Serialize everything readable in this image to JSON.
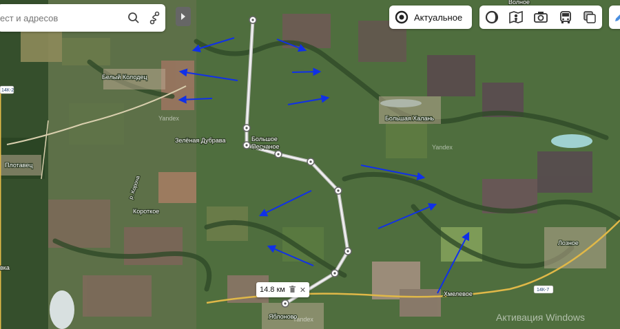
{
  "search": {
    "placeholder": "ест и адресов"
  },
  "actual_button": {
    "label": "Актуальное"
  },
  "layers": [
    "traffic-icon",
    "panorama-icon",
    "photo-icon",
    "transit-icon",
    "layers-icon"
  ],
  "distance": {
    "value": "14.8 км"
  },
  "places": {
    "belyi_kolodets": "Белый Колодец",
    "plotavets": "Плотавец",
    "zelenaya_dubrava": "Зелёная Дубрава",
    "bolshoe": "Большое",
    "pesschanoe": "Песчаное",
    "bolshaya_khalan": "Большая Халань",
    "korotkoe": "Короткое",
    "r_korocha": "р. Короча",
    "loznoe": "Лозное",
    "khmelevoe": "Хмелевое",
    "yablonovo": "Яблоново",
    "volkovka": "вка",
    "volnoe": "Волное"
  },
  "roads": {
    "r14k2": "14К-2",
    "r14k7": "14К-7"
  },
  "watermarks": {
    "yandex": "Yandex"
  },
  "activation": "Активация Windows",
  "colors": {
    "arrow": "#1030e8",
    "route": "#e6e6e6",
    "field_dark": "#3f5a2f",
    "field_brown": "#8a6a55"
  }
}
